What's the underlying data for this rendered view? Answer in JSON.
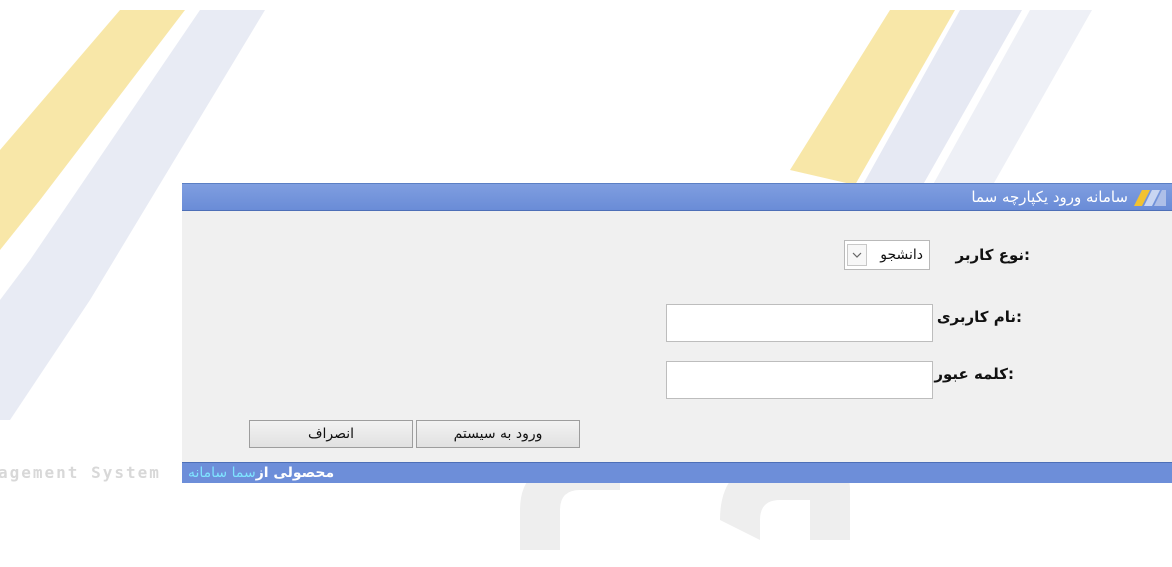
{
  "header": {
    "title": "سامانه ورود یکپارچه سما",
    "logo_icon": "sama-logo-icon"
  },
  "form": {
    "user_type": {
      "label": "نوع کاربر:",
      "value": "دانشجو"
    },
    "username": {
      "label": "نام کاربری:",
      "value": ""
    },
    "password": {
      "label": "کلمه عبور:",
      "value": ""
    }
  },
  "buttons": {
    "login": "ورود به سیستم",
    "cancel": "انصراف"
  },
  "footer": {
    "prefix": "محصولی از",
    "brand": "سما سامانه"
  },
  "background": {
    "watermark_text": "agement System"
  },
  "colors": {
    "accent": "#6d8ed9",
    "footer_brand": "#7fe3ff"
  }
}
